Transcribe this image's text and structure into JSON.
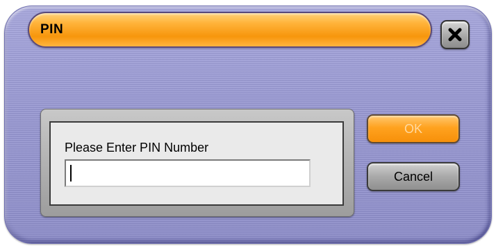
{
  "dialog": {
    "title": "PIN",
    "close_icon": "close-x-icon",
    "prompt_label": "Please Enter PIN Number",
    "pin_value": "",
    "ok_label": "OK",
    "ok_enabled": false,
    "cancel_label": "Cancel"
  },
  "colors": {
    "window_background": "#9a9ad4",
    "title_bar_accent": "#ffb33a",
    "ok_button_accent": "#ffa21f",
    "cancel_button": "#a9a9a9",
    "panel_background": "#eaeaea"
  }
}
